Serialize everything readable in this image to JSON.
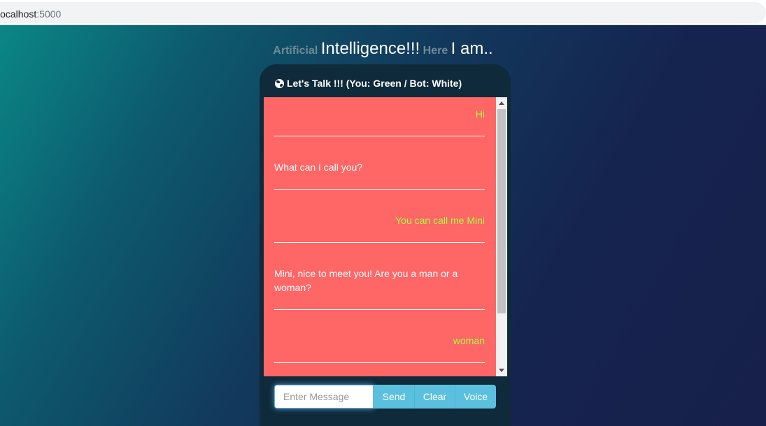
{
  "browser": {
    "url_host": "localhost",
    "url_port": ":5000"
  },
  "heading": {
    "part1": "Artificial",
    "part2": "Intelligence!!!",
    "part3": "Here",
    "part4": "I am.."
  },
  "chat": {
    "title": "Let's Talk !!! (You: Green / Bot: White)",
    "messages": [
      {
        "sender": "user",
        "text": "Hi"
      },
      {
        "sender": "bot",
        "text": "What can I call you?"
      },
      {
        "sender": "user",
        "text": "You can call me Mini"
      },
      {
        "sender": "bot",
        "text": "Mini, nice to meet you! Are you a man or a woman?"
      },
      {
        "sender": "user",
        "text": "woman"
      }
    ],
    "input_placeholder": "Enter Message",
    "send_label": "Send",
    "clear_label": "Clear",
    "voice_label": "Voice"
  },
  "colors": {
    "user_text": "#a6ff3a",
    "bot_text": "#ffffff",
    "chat_background": "#ff6666",
    "button": "#5bc0de"
  },
  "icons": {
    "header": "globe-icon"
  }
}
